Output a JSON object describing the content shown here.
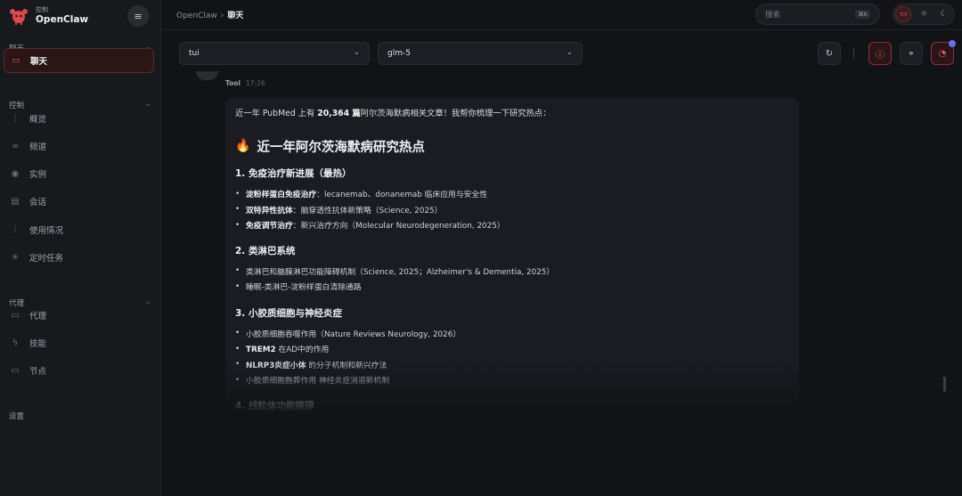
{
  "brand": {
    "sub": "控制",
    "name": "OpenClaw"
  },
  "sidebar": {
    "sections": [
      {
        "label": "聊天",
        "items": [
          {
            "label": "聊天",
            "icon": "chat-bubble-icon",
            "glyph": "▭",
            "active": true
          }
        ]
      },
      {
        "label": "控制",
        "items": [
          {
            "label": "概览",
            "icon": "bar-chart-icon",
            "glyph": "⫶"
          },
          {
            "label": "频道",
            "icon": "link-icon",
            "glyph": "∞"
          },
          {
            "label": "实例",
            "icon": "broadcast-icon",
            "glyph": "◉"
          },
          {
            "label": "会话",
            "icon": "document-icon",
            "glyph": "▤"
          },
          {
            "label": "使用情况",
            "icon": "bar-chart-icon",
            "glyph": "⫶"
          },
          {
            "label": "定时任务",
            "icon": "loader-icon",
            "glyph": "✳"
          }
        ]
      },
      {
        "label": "代理",
        "items": [
          {
            "label": "代理",
            "icon": "folder-icon",
            "glyph": "▭"
          },
          {
            "label": "技能",
            "icon": "lightning-icon",
            "glyph": "ϟ"
          },
          {
            "label": "节点",
            "icon": "monitor-icon",
            "glyph": "▭"
          }
        ]
      },
      {
        "label": "设置",
        "items": []
      }
    ]
  },
  "header": {
    "breadcrumb_root": "OpenClaw",
    "breadcrumb_sep": "›",
    "breadcrumb_current": "聊天"
  },
  "search": {
    "placeholder": "搜索",
    "shortcut": "⌘K"
  },
  "controls": {
    "session_select": "tui",
    "model_select": "glm-5"
  },
  "message": {
    "sender": "Tool",
    "time": "17:26",
    "intro_pre": "近一年 PubMed 上有 ",
    "intro_bold": "20,364 篇",
    "intro_post": "阿尔茨海默病相关文章！我帮你梳理一下研究热点：",
    "heading": "近一年阿尔茨海默病研究热点",
    "sections": [
      {
        "title": "1. 免疫治疗新进展（最热）",
        "items": [
          {
            "bold": "淀粉样蛋白免疫治疗",
            "text": "：lecanemab、donanemab 临床应用与安全性"
          },
          {
            "bold": "双特异性抗体",
            "text": "：脑穿透性抗体新策略（Science, 2025）"
          },
          {
            "bold": "免疫调节治疗",
            "text": "：新兴治疗方向（Molecular Neurodegeneration, 2025）"
          }
        ]
      },
      {
        "title": "2. 类淋巴系统",
        "items": [
          {
            "bold": "",
            "text": "类淋巴和脑膜淋巴功能障碍机制（Science, 2025；Alzheimer's & Dementia, 2025）"
          },
          {
            "bold": "",
            "text": "睡眠-类淋巴-淀粉样蛋白清除通路"
          }
        ]
      },
      {
        "title": "3. 小胶质细胞与神经炎症",
        "items": [
          {
            "bold": "",
            "text": "小胶质细胞吞噬作用（Nature Reviews Neurology, 2026）"
          },
          {
            "bold": "TREM2",
            "text": " 在AD中的作用"
          },
          {
            "bold": "NLRP3炎症小体",
            "text": " 的分子机制和新兴疗法"
          },
          {
            "bold": "",
            "text": "小胶质细胞胞葬作用 神经炎症消退新机制"
          }
        ]
      },
      {
        "title": "4. 线粒体功能障碍",
        "items": []
      }
    ]
  }
}
